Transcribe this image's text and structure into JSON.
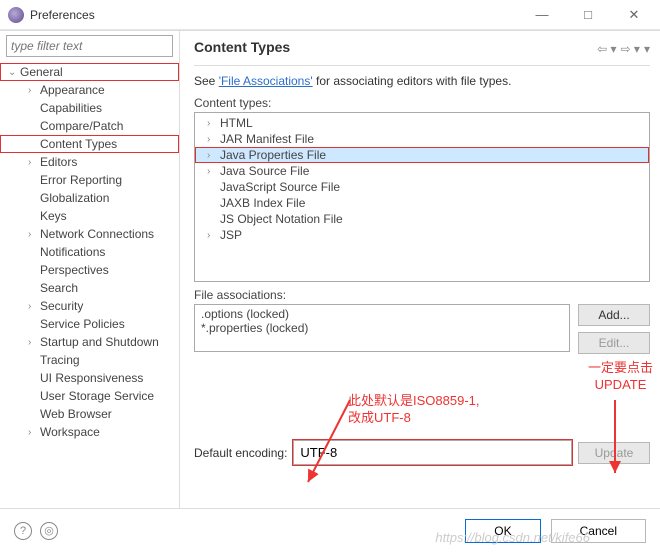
{
  "window": {
    "title": "Preferences",
    "minimize": "—",
    "maximize": "□",
    "close": "✕"
  },
  "sidebar": {
    "filter_placeholder": "type filter text",
    "items": [
      {
        "label": "General",
        "level": 1,
        "arrow": "v",
        "boxed": true
      },
      {
        "label": "Appearance",
        "level": 2,
        "arrow": ">"
      },
      {
        "label": "Capabilities",
        "level": 2,
        "arrow": ""
      },
      {
        "label": "Compare/Patch",
        "level": 2,
        "arrow": ""
      },
      {
        "label": "Content Types",
        "level": 2,
        "arrow": "",
        "boxed": true
      },
      {
        "label": "Editors",
        "level": 2,
        "arrow": ">"
      },
      {
        "label": "Error Reporting",
        "level": 2,
        "arrow": ""
      },
      {
        "label": "Globalization",
        "level": 2,
        "arrow": ""
      },
      {
        "label": "Keys",
        "level": 2,
        "arrow": ""
      },
      {
        "label": "Network Connections",
        "level": 2,
        "arrow": ">"
      },
      {
        "label": "Notifications",
        "level": 2,
        "arrow": ""
      },
      {
        "label": "Perspectives",
        "level": 2,
        "arrow": ""
      },
      {
        "label": "Search",
        "level": 2,
        "arrow": ""
      },
      {
        "label": "Security",
        "level": 2,
        "arrow": ">"
      },
      {
        "label": "Service Policies",
        "level": 2,
        "arrow": ""
      },
      {
        "label": "Startup and Shutdown",
        "level": 2,
        "arrow": ">"
      },
      {
        "label": "Tracing",
        "level": 2,
        "arrow": ""
      },
      {
        "label": "UI Responsiveness",
        "level": 2,
        "arrow": ""
      },
      {
        "label": "User Storage Service",
        "level": 2,
        "arrow": ""
      },
      {
        "label": "Web Browser",
        "level": 2,
        "arrow": ""
      },
      {
        "label": "Workspace",
        "level": 2,
        "arrow": ">"
      }
    ]
  },
  "content": {
    "heading": "Content Types",
    "desc_prefix": "See ",
    "desc_link": "'File Associations'",
    "desc_suffix": " for associating editors with file types.",
    "types_label": "Content types:",
    "types": [
      {
        "label": "HTML",
        "arrow": ">"
      },
      {
        "label": "JAR Manifest File",
        "arrow": ">"
      },
      {
        "label": "Java Properties File",
        "arrow": ">",
        "selected": true
      },
      {
        "label": "Java Source File",
        "arrow": ">"
      },
      {
        "label": "JavaScript Source File",
        "arrow": ""
      },
      {
        "label": "JAXB Index File",
        "arrow": ""
      },
      {
        "label": "JS Object Notation File",
        "arrow": ""
      },
      {
        "label": "JSP",
        "arrow": ">"
      }
    ],
    "assoc_label": "File associations:",
    "assoc_items": [
      ".options (locked)",
      "*.properties (locked)"
    ],
    "buttons": {
      "add": "Add...",
      "edit": "Edit...",
      "update": "Update"
    },
    "encoding_label": "Default encoding:",
    "encoding_value": "UTF-8"
  },
  "annotations": {
    "note1": "此处默认是ISO8859-1,\n改成UTF-8",
    "note2": "一定要点击\nUPDATE"
  },
  "footer": {
    "ok": "OK",
    "cancel": "Cancel"
  },
  "watermark": "https://blog.csdn.net/kife66"
}
